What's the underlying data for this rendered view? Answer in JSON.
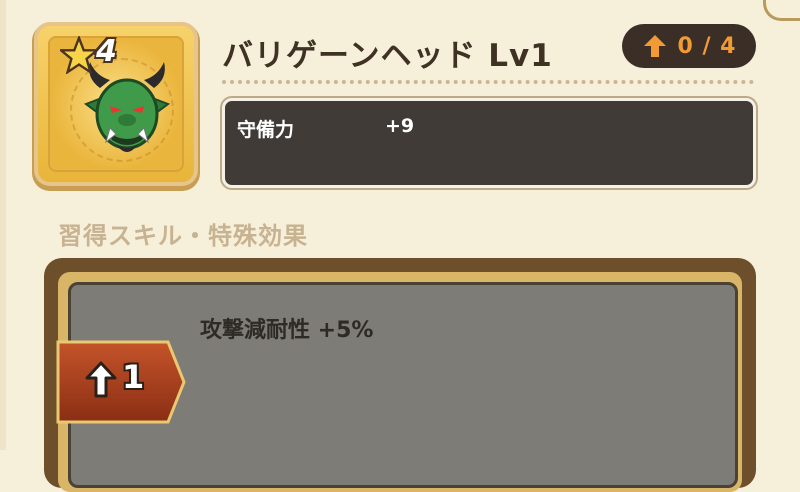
{
  "item": {
    "name": "バリゲーンヘッド Lv1",
    "star_rank": "4",
    "icon": "orc-head-icon"
  },
  "upgrade": {
    "icon": "up-arrow-icon",
    "count": "0 / 4",
    "current": 0,
    "max": 4
  },
  "stats": {
    "label": "守備力",
    "value": "+9"
  },
  "skills": {
    "section_title": "習得スキル・特殊効果",
    "entries": [
      {
        "level": "1",
        "text": "攻撃減耐性 +5%"
      }
    ]
  },
  "colors": {
    "accent_orange": "#f29a34",
    "panel_dark": "#403b37",
    "background": "#f6efd9",
    "frame_gold": "#e8b53a"
  }
}
